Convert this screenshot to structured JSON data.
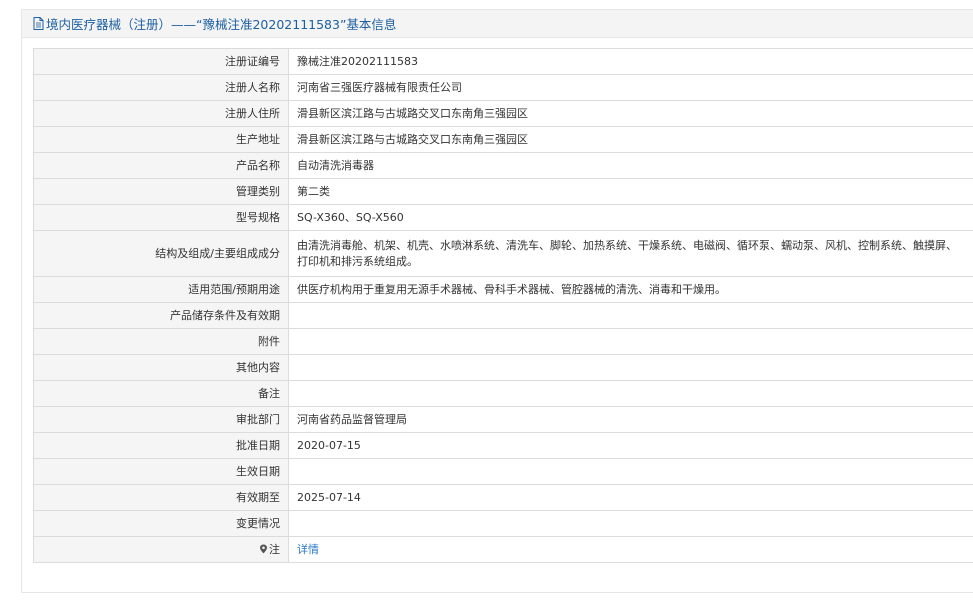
{
  "header": {
    "title": "境内医疗器械（注册）——“豫械注准20202111583”基本信息",
    "icon": "document-icon"
  },
  "rows": [
    {
      "label": "注册证编号",
      "value": "豫械注准20202111583"
    },
    {
      "label": "注册人名称",
      "value": "河南省三强医疗器械有限责任公司"
    },
    {
      "label": "注册人住所",
      "value": "滑县新区滨江路与古城路交叉口东南角三强园区"
    },
    {
      "label": "生产地址",
      "value": "滑县新区滨江路与古城路交叉口东南角三强园区"
    },
    {
      "label": "产品名称",
      "value": "自动清洗消毒器"
    },
    {
      "label": "管理类别",
      "value": "第二类"
    },
    {
      "label": "型号规格",
      "value": "SQ-X360、SQ-X560"
    },
    {
      "label": "结构及组成/主要组成成分",
      "value": "由清洗消毒舱、机架、机壳、水喷淋系统、清洗车、脚轮、加热系统、干燥系统、电磁阀、循环泵、蠕动泵、风机、控制系统、触摸屏、打印机和排污系统组成。"
    },
    {
      "label": "适用范围/预期用途",
      "value": "供医疗机构用于重复用无源手术器械、骨科手术器械、管腔器械的清洗、消毒和干燥用。"
    },
    {
      "label": "产品储存条件及有效期",
      "value": ""
    },
    {
      "label": "附件",
      "value": ""
    },
    {
      "label": "其他内容",
      "value": ""
    },
    {
      "label": "备注",
      "value": ""
    },
    {
      "label": "审批部门",
      "value": "河南省药品监督管理局"
    },
    {
      "label": "批准日期",
      "value": "2020-07-15"
    },
    {
      "label": "生效日期",
      "value": ""
    },
    {
      "label": "有效期至",
      "value": "2025-07-14"
    },
    {
      "label": "变更情况",
      "value": ""
    }
  ],
  "note_row": {
    "label": "注",
    "icon": "pin-icon",
    "link_text": "详情"
  }
}
